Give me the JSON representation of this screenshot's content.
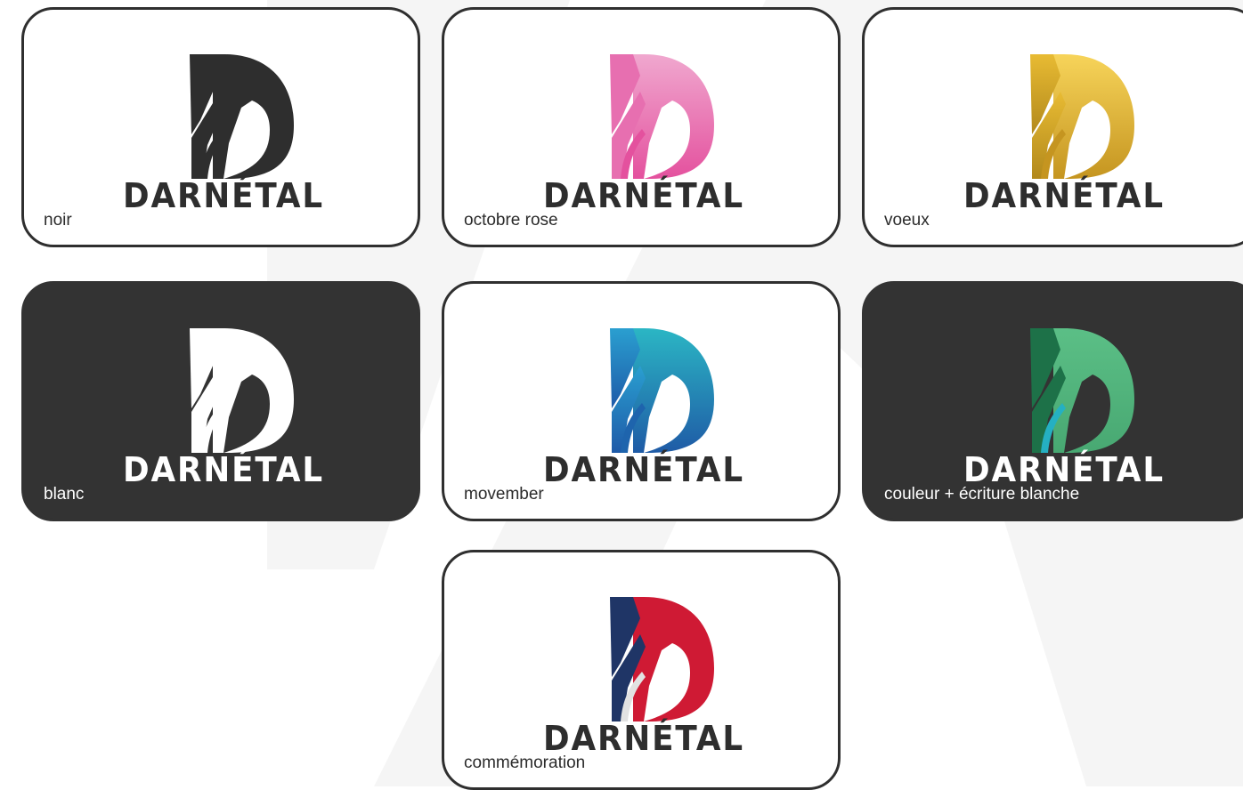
{
  "cards": [
    {
      "label": "noir",
      "theme": "light",
      "colors": {
        "a1": "#2e2e2e",
        "a2": "#2e2e2e",
        "d1": "#2e2e2e",
        "d2": "#2e2e2e",
        "stroke": "#2e2e2e",
        "text": "#2e2e2e"
      }
    },
    {
      "label": "octobre rose",
      "theme": "light",
      "colors": {
        "a1": "#e76fb0",
        "a2": "#e76fb0",
        "d1": "#f0a8cf",
        "d2": "#e4519e",
        "stroke": "#e4519e",
        "text": "#2e2e2e"
      }
    },
    {
      "label": "voeux",
      "theme": "light",
      "colors": {
        "a1": "#e8bb33",
        "a2": "#b2891c",
        "d1": "#f7d45a",
        "d2": "#c59520",
        "stroke": "#c59520",
        "text": "#2e2e2e"
      }
    },
    {
      "label": "blanc",
      "theme": "dark",
      "colors": {
        "a1": "#ffffff",
        "a2": "#ffffff",
        "d1": "#ffffff",
        "d2": "#ffffff",
        "stroke": "#ffffff",
        "text": "#ffffff"
      }
    },
    {
      "label": "movember",
      "theme": "light",
      "colors": {
        "a1": "#2a9fd0",
        "a2": "#1e5aa8",
        "d1": "#2bb6c4",
        "d2": "#1f5ba6",
        "stroke": "#1e64ad",
        "text": "#2e2e2e"
      }
    },
    {
      "label": "couleur + écriture blanche",
      "theme": "dark",
      "colors": {
        "a1": "#1d7148",
        "a2": "#1d7148",
        "d1": "#5bbf86",
        "d2": "#48a872",
        "stroke": "#25b0c2",
        "text": "#ffffff"
      }
    },
    {
      "label": "commémoration",
      "theme": "light",
      "colors": {
        "a1": "#1f3566",
        "a2": "#1f3566",
        "d1": "#cf1a34",
        "d2": "#cf1a34",
        "stroke": "#e2e2e2",
        "text": "#2e2e2e"
      }
    }
  ],
  "wordmark": "DARNÉTAL",
  "watermark_color": "#f4f4f4",
  "icons": {
    "logo": "darnetal-d-logo-icon"
  }
}
